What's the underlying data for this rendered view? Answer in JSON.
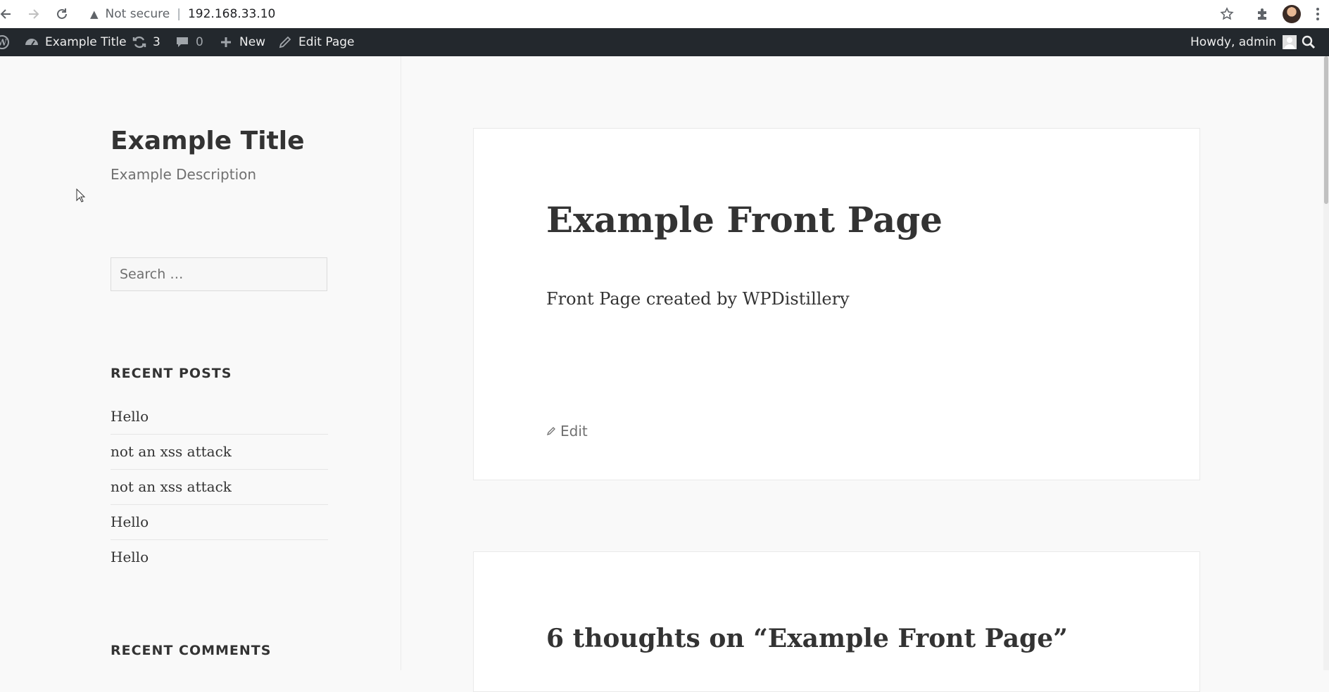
{
  "browser": {
    "security_label": "Not secure",
    "url": "192.168.33.10",
    "icons": [
      "back-icon",
      "forward-icon",
      "reload-icon",
      "warning-icon",
      "star-icon",
      "extensions-icon",
      "profile-avatar",
      "menu-icon"
    ]
  },
  "adminbar": {
    "site_name": "Example Title",
    "updates_count": "3",
    "comments_count": "0",
    "new_label": "New",
    "edit_label": "Edit Page",
    "howdy": "Howdy, admin"
  },
  "sidebar": {
    "site_title": "Example Title",
    "site_description": "Example Description",
    "search_placeholder": "Search …",
    "recent_posts_title": "RECENT POSTS",
    "recent_posts": [
      "Hello",
      "not an xss attack",
      "not an xss attack",
      "Hello",
      "Hello"
    ],
    "recent_comments_title": "RECENT COMMENTS"
  },
  "article": {
    "title": "Example Front Page",
    "content": "Front Page created by WPDistillery",
    "edit_label": "Edit"
  },
  "comments": {
    "title": "6 thoughts on “Example Front Page”"
  },
  "colors": {
    "adminbar_bg": "#23282d",
    "page_bg": "#f9f9f9",
    "card_bg": "#ffffff",
    "text": "#333333",
    "muted": "#707070"
  }
}
